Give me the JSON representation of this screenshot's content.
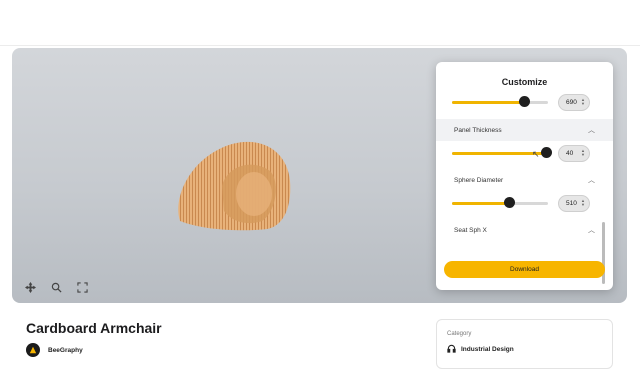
{
  "panel": {
    "title": "Customize",
    "params": [
      {
        "label": "",
        "value": "690",
        "level": 0.75
      },
      {
        "label": "Panel Thickness",
        "value": "40",
        "level": 0.98
      },
      {
        "label": "Sphere Diameter",
        "value": "510",
        "level": 0.6
      },
      {
        "label": "Seat Sph X",
        "value": ""
      }
    ],
    "download_label": "Download"
  },
  "product": {
    "title": "Cardboard Armchair",
    "author": "BeeGraphy"
  },
  "category": {
    "label": "Category",
    "value": "Industrial Design"
  },
  "icons": [
    "move-icon",
    "zoom-icon",
    "fullscreen-icon",
    "chevron-up-icon",
    "headphones-icon"
  ],
  "colors": {
    "accent": "#f7b500",
    "knob": "#1f1f1f",
    "viewer_bg": "#c6cacf"
  }
}
